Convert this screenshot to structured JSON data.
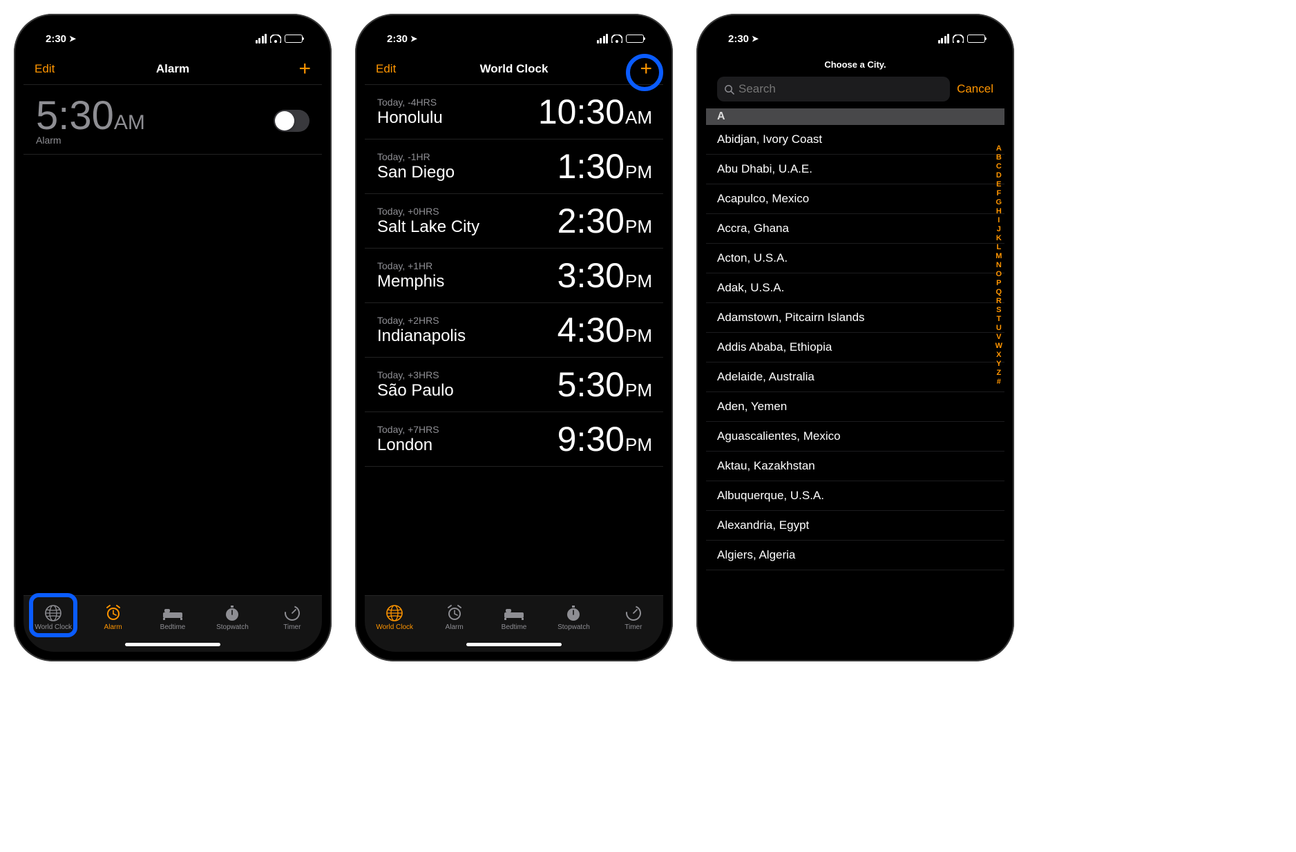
{
  "status": {
    "time": "2:30"
  },
  "screen1": {
    "nav": {
      "edit": "Edit",
      "title": "Alarm",
      "add": "+"
    },
    "alarm": {
      "time": "5:30",
      "ampm": "AM",
      "label": "Alarm",
      "enabled": false
    },
    "tabs": [
      {
        "label": "World Clock",
        "active": false
      },
      {
        "label": "Alarm",
        "active": true
      },
      {
        "label": "Bedtime",
        "active": false
      },
      {
        "label": "Stopwatch",
        "active": false
      },
      {
        "label": "Timer",
        "active": false
      }
    ]
  },
  "screen2": {
    "nav": {
      "edit": "Edit",
      "title": "World Clock",
      "add": "+"
    },
    "clocks": [
      {
        "offset": "Today, -4HRS",
        "city": "Honolulu",
        "time": "10:30",
        "ampm": "AM"
      },
      {
        "offset": "Today, -1HR",
        "city": "San Diego",
        "time": "1:30",
        "ampm": "PM"
      },
      {
        "offset": "Today, +0HRS",
        "city": "Salt Lake City",
        "time": "2:30",
        "ampm": "PM"
      },
      {
        "offset": "Today, +1HR",
        "city": "Memphis",
        "time": "3:30",
        "ampm": "PM"
      },
      {
        "offset": "Today, +2HRS",
        "city": "Indianapolis",
        "time": "4:30",
        "ampm": "PM"
      },
      {
        "offset": "Today, +3HRS",
        "city": "São Paulo",
        "time": "5:30",
        "ampm": "PM"
      },
      {
        "offset": "Today, +7HRS",
        "city": "London",
        "time": "9:30",
        "ampm": "PM"
      }
    ],
    "tabs": [
      {
        "label": "World Clock",
        "active": true
      },
      {
        "label": "Alarm",
        "active": false
      },
      {
        "label": "Bedtime",
        "active": false
      },
      {
        "label": "Stopwatch",
        "active": false
      },
      {
        "label": "Timer",
        "active": false
      }
    ]
  },
  "screen3": {
    "title": "Choose a City.",
    "search_placeholder": "Search",
    "cancel": "Cancel",
    "section": "A",
    "cities": [
      "Abidjan, Ivory Coast",
      "Abu Dhabi, U.A.E.",
      "Acapulco, Mexico",
      "Accra, Ghana",
      "Acton, U.S.A.",
      "Adak, U.S.A.",
      "Adamstown, Pitcairn Islands",
      "Addis Ababa, Ethiopia",
      "Adelaide, Australia",
      "Aden, Yemen",
      "Aguascalientes, Mexico",
      "Aktau, Kazakhstan",
      "Albuquerque, U.S.A.",
      "Alexandria, Egypt",
      "Algiers, Algeria"
    ],
    "index": [
      "A",
      "B",
      "C",
      "D",
      "E",
      "F",
      "G",
      "H",
      "I",
      "J",
      "K",
      "L",
      "M",
      "N",
      "O",
      "P",
      "Q",
      "R",
      "S",
      "T",
      "U",
      "V",
      "W",
      "X",
      "Y",
      "Z",
      "#"
    ]
  }
}
